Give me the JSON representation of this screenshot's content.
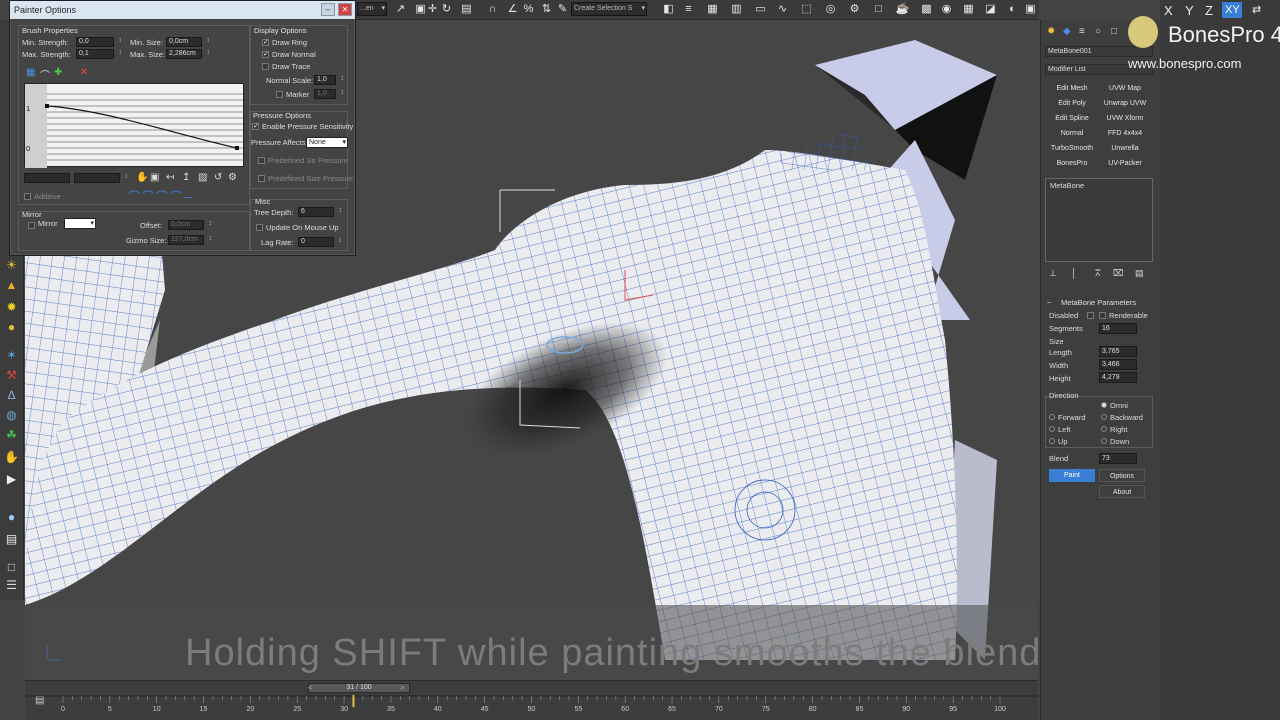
{
  "top_toolbar": {
    "view_dropdown": "...en",
    "selection_set_placeholder": "Create Selection S"
  },
  "painter_options": {
    "title": "Painter Options",
    "brush_properties": {
      "title": "Brush Properties",
      "min_strength_label": "Min. Strength:",
      "min_strength": "0,0",
      "max_strength_label": "Max. Strength:",
      "max_strength": "0,1",
      "min_size_label": "Min. Size:",
      "min_size": "0,0cm",
      "max_size_label": "Max. Size:",
      "max_size": "2,286cm",
      "curve_label_top": "1",
      "curve_label_bottom": "0",
      "additive_label": "Additive"
    },
    "mirror": {
      "title": "Mirror",
      "mirror_label": "Mirror",
      "offset_label": "Offset:",
      "offset": "0,0cm",
      "gizmo_size_label": "Gizmo Size:",
      "gizmo_size": "127,0cm"
    },
    "display_options": {
      "title": "Display Options",
      "draw_ring": "Draw Ring",
      "draw_normal": "Draw Normal",
      "draw_trace": "Draw Trace",
      "normal_scale_label": "Normal Scale:",
      "normal_scale": "1,0",
      "marker_label": "Marker",
      "marker": "1,0"
    },
    "pressure_options": {
      "title": "Pressure Options",
      "enable_pressure": "Enable Pressure Sensitivity",
      "pressure_affects_label": "Pressure Affects:",
      "pressure_affects": "None",
      "predefined_str": "Predefined Str Pressure",
      "predefined_size": "Predefined Size Pressure"
    },
    "misc": {
      "title": "Misc",
      "tree_depth_label": "Tree Depth:",
      "tree_depth": "6",
      "update_on_mouse_up": "Update On Mouse Up",
      "lag_rate_label": "Lag Rate:",
      "lag_rate": "0"
    }
  },
  "command_panel": {
    "object_name": "MetaBone001",
    "modifier_list_label": "Modifier List",
    "modifier_buttons": [
      "Edit Mesh",
      "UVW Map",
      "Edit Poly",
      "Unwrap UVW",
      "Edit Spline",
      "UVW Xform",
      "Normal",
      "FFD 4x4x4",
      "TurboSmooth",
      "Unwrella",
      "BonesPro",
      "UV-Packer"
    ],
    "stack_item": "MetaBone",
    "params": {
      "title": "MetaBone Parameters",
      "disabled_label": "Disabled",
      "renderable_label": "Renderable",
      "segments_label": "Segments",
      "segments": "16",
      "size_label": "Size",
      "length_label": "Length",
      "length": "3,765",
      "width_label": "Width",
      "width": "3,466",
      "height_label": "Height",
      "height": "4,279",
      "direction_label": "Direction",
      "omni": "Omni",
      "forward": "Forward",
      "backward": "Backward",
      "left": "Left",
      "right": "Right",
      "up": "Up",
      "down": "Down",
      "blend_label": "Blend",
      "blend": "73",
      "paint_button": "Paint",
      "options_button": "Options",
      "about_button": "About"
    }
  },
  "right_toolbar": {
    "axis_x": "X",
    "axis_y": "Y",
    "axis_z": "Z",
    "axis_xy": "XY",
    "brand_title": "BonesPro 4",
    "brand_url": "www.bonespro.com"
  },
  "viewport": {
    "caption": "Holding SHIFT while painting smooths the blendings"
  },
  "timeline": {
    "frame_indicator": "31 / 100",
    "current_frame": 31,
    "ticks": [
      "0",
      "5",
      "10",
      "15",
      "20",
      "25",
      "30",
      "35",
      "40",
      "45",
      "50",
      "55",
      "60",
      "65",
      "70",
      "75",
      "80",
      "85",
      "90",
      "95",
      "100"
    ]
  },
  "colors": {
    "ui_dark": "#3c3c3c",
    "viewport_bg": "#464646",
    "accent_blue": "#3a7fd5",
    "wire_blue": "#2a5fc0",
    "title_bar": "#d9e6f2"
  }
}
